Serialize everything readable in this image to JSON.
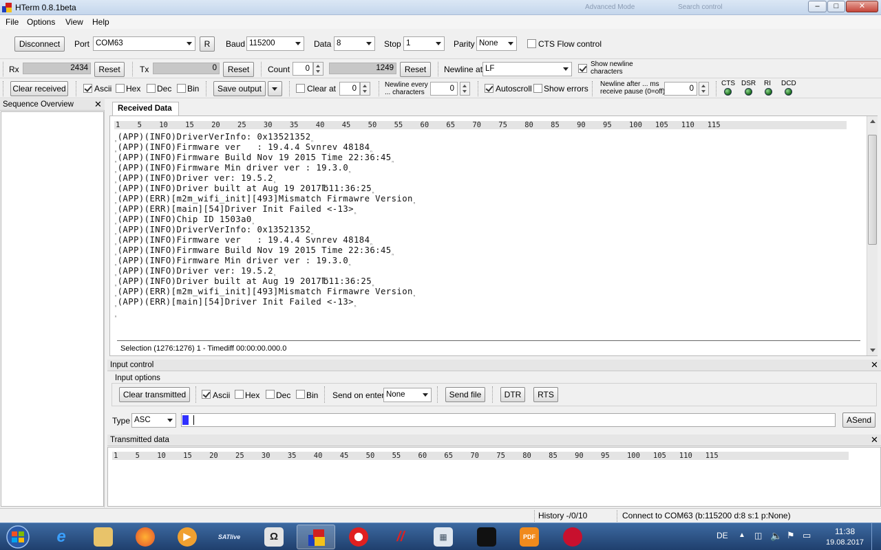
{
  "window": {
    "title": "HTerm 0.8.1beta",
    "ghost_left": "Advanced Mode",
    "ghost_right": "Search control"
  },
  "menu": [
    "File",
    "Options",
    "View",
    "Help"
  ],
  "conn": {
    "disconnect": "Disconnect",
    "port_label": "Port",
    "port_value": "COM63",
    "r_button": "R",
    "baud_label": "Baud",
    "baud_value": "115200",
    "data_label": "Data",
    "data_value": "8",
    "stop_label": "Stop",
    "stop_value": "1",
    "parity_label": "Parity",
    "parity_value": "None",
    "cts_label": "CTS Flow control"
  },
  "counters": {
    "rx_label": "Rx",
    "rx_value": "2434",
    "reset": "Reset",
    "tx_label": "Tx",
    "tx_value": "0",
    "count_label": "Count",
    "count_value": "0",
    "count_display": "1249",
    "newline_label": "Newline at",
    "newline_value": "LF",
    "show_newline_1": "Show newline",
    "show_newline_2": "characters"
  },
  "recv_toolbar": {
    "clear_received": "Clear received",
    "ascii": "Ascii",
    "hex": "Hex",
    "dec": "Dec",
    "bin": "Bin",
    "save_output": "Save output",
    "clear_at": "Clear at",
    "clear_at_value": "0",
    "newline_every_1": "Newline every",
    "newline_every_2": "... characters",
    "newline_every_value": "0",
    "autoscroll": "Autoscroll",
    "show_errors": "Show errors",
    "newline_after_1": "Newline after ... ms",
    "newline_after_2": "receive pause (0=off)",
    "newline_after_value": "0",
    "leds": [
      "CTS",
      "DSR",
      "RI",
      "DCD"
    ]
  },
  "sequence_overview": {
    "title": "Sequence Overview"
  },
  "received": {
    "tab": "Received Data",
    "ruler": "1    5    10    15    20    25    30    35    40    45    50    55    60    65    70    75    80    85    90    95    100   105   110   115",
    "lines": [
      "(APP)(INFO)DriverVerInfo: 0x13521352",
      "(APP)(INFO)Firmware ver   : 19.4.4 Svnrev 48184",
      "(APP)(INFO)Firmware Build Nov 19 2015 Time 22:36:45",
      "(APP)(INFO)Firmware Min driver ver : 19.3.0",
      "(APP)(INFO)Driver ver: 19.5.2",
      "(APP)(INFO)Driver built at Aug 19 2017℔11:36:25",
      "(APP)(ERR)[m2m_wifi_init][493]Mismatch Firmawre Version",
      "(APP)(ERR)[main][54]Driver Init Failed <-13>",
      "(APP)(INFO)Chip ID 1503a0",
      "(APP)(INFO)DriverVerInfo: 0x13521352",
      "(APP)(INFO)Firmware ver   : 19.4.4 Svnrev 48184",
      "(APP)(INFO)Firmware Build Nov 19 2015 Time 22:36:45",
      "(APP)(INFO)Firmware Min driver ver : 19.3.0",
      "(APP)(INFO)Driver ver: 19.5.2",
      "(APP)(INFO)Driver built at Aug 19 2017℔11:36:25",
      "(APP)(ERR)[m2m_wifi_init][493]Mismatch Firmawre Version",
      "(APP)(ERR)[main][54]Driver Init Failed <-13>",
      ""
    ],
    "selection": "Selection (1276:1276) 1  -  Timediff 00:00:00.000.0"
  },
  "input_control": {
    "title": "Input control",
    "options_label": "Input options",
    "clear_transmitted": "Clear transmitted",
    "ascii": "Ascii",
    "hex": "Hex",
    "dec": "Dec",
    "bin": "Bin",
    "send_on_enter_label": "Send on enter",
    "send_on_enter_value": "None",
    "send_file": "Send file",
    "dtr": "DTR",
    "rts": "RTS",
    "type_label": "Type",
    "type_value": "ASC",
    "asend": "ASend"
  },
  "transmitted": {
    "title": "Transmitted data"
  },
  "status": {
    "history": "History -/0/10",
    "connection": "Connect to COM63 (b:115200 d:8 s:1 p:None)"
  },
  "taskbar": {
    "lang": "DE",
    "time": "11:38",
    "date": "19.08.2017",
    "satlive": "SATlive"
  }
}
